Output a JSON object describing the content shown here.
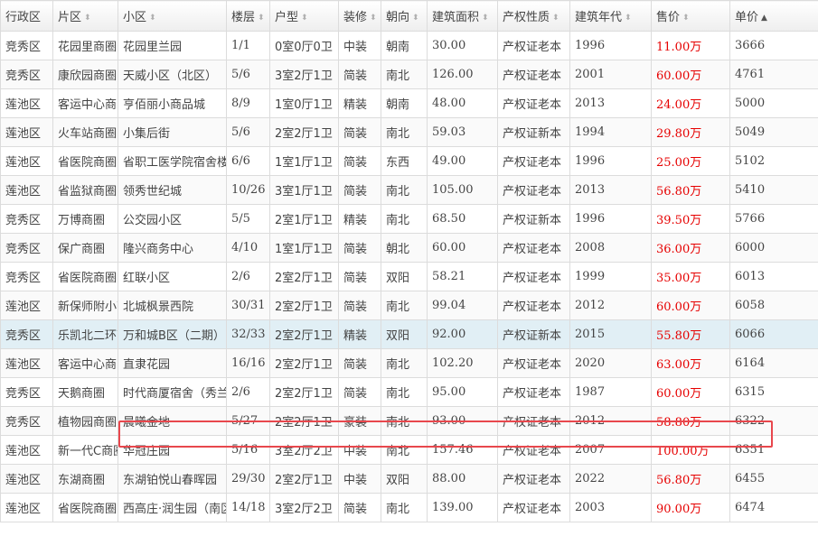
{
  "table": {
    "headers": [
      {
        "label": "行政区",
        "sortable": false
      },
      {
        "label": "片区",
        "sortable": true
      },
      {
        "label": "小区",
        "sortable": true
      },
      {
        "label": "楼层",
        "sortable": true
      },
      {
        "label": "户型",
        "sortable": true
      },
      {
        "label": "装修",
        "sortable": true
      },
      {
        "label": "朝向",
        "sortable": true
      },
      {
        "label": "建筑面积",
        "sortable": true
      },
      {
        "label": "产权性质",
        "sortable": true
      },
      {
        "label": "建筑年代",
        "sortable": true
      },
      {
        "label": "售价",
        "sortable": true
      },
      {
        "label": "单价",
        "sortable": true,
        "sort_direction": "asc"
      }
    ],
    "selected_row_index": 10,
    "boxed_row_index": 13,
    "rows": [
      [
        "竞秀区",
        "花园里商圈",
        "花园里兰园",
        "1/1",
        "0室0厅0卫",
        "中装",
        "朝南",
        "30.00",
        "产权证老本",
        "1996",
        "11.00万",
        "3666"
      ],
      [
        "竞秀区",
        "康欣园商圈",
        "天威小区（北区）",
        "5/6",
        "3室2厅1卫",
        "简装",
        "南北",
        "126.00",
        "产权证老本",
        "2001",
        "60.00万",
        "4761"
      ],
      [
        "莲池区",
        "客运中心商圈",
        "亨佰丽小商品城",
        "8/9",
        "1室0厅1卫",
        "精装",
        "朝南",
        "48.00",
        "产权证老本",
        "2013",
        "24.00万",
        "5000"
      ],
      [
        "莲池区",
        "火车站商圈",
        "小集后街",
        "5/6",
        "2室2厅1卫",
        "简装",
        "南北",
        "59.03",
        "产权证新本",
        "1994",
        "29.80万",
        "5049"
      ],
      [
        "莲池区",
        "省医院商圈",
        "省职工医学院宿舍楼",
        "6/6",
        "1室1厅1卫",
        "简装",
        "东西",
        "49.00",
        "产权证老本",
        "1996",
        "25.00万",
        "5102"
      ],
      [
        "莲池区",
        "省监狱商圈",
        "领秀世纪城",
        "10/26",
        "3室1厅1卫",
        "简装",
        "南北",
        "105.00",
        "产权证老本",
        "2013",
        "56.80万",
        "5410"
      ],
      [
        "竞秀区",
        "万博商圈",
        "公交园小区",
        "5/5",
        "2室1厅1卫",
        "精装",
        "南北",
        "68.50",
        "产权证新本",
        "1996",
        "39.50万",
        "5766"
      ],
      [
        "竞秀区",
        "保广商圈",
        "隆兴商务中心",
        "4/10",
        "1室1厅1卫",
        "简装",
        "朝北",
        "60.00",
        "产权证老本",
        "2008",
        "36.00万",
        "6000"
      ],
      [
        "竞秀区",
        "省医院商圈",
        "红联小区",
        "2/6",
        "2室2厅1卫",
        "简装",
        "双阳",
        "58.21",
        "产权证老本",
        "1999",
        "35.00万",
        "6013"
      ],
      [
        "莲池区",
        "新保师附小商圈",
        "北城枫景西院",
        "30/31",
        "2室2厅1卫",
        "简装",
        "南北",
        "99.04",
        "产权证老本",
        "2012",
        "60.00万",
        "6058"
      ],
      [
        "竞秀区",
        "乐凯北二环商圈",
        "万和城B区（二期）",
        "32/33",
        "2室2厅1卫",
        "精装",
        "双阳",
        "92.00",
        "产权证新本",
        "2015",
        "55.80万",
        "6066"
      ],
      [
        "莲池区",
        "客运中心商圈",
        "直隶花园",
        "16/16",
        "2室2厅1卫",
        "简装",
        "南北",
        "102.20",
        "产权证老本",
        "2020",
        "63.00万",
        "6164"
      ],
      [
        "竞秀区",
        "天鹅商圈",
        "时代商厦宿舍（秀兰）",
        "2/6",
        "2室2厅1卫",
        "简装",
        "南北",
        "95.00",
        "产权证老本",
        "1987",
        "60.00万",
        "6315"
      ],
      [
        "竞秀区",
        "植物园商圈",
        "晨曦金地",
        "5/27",
        "2室2厅1卫",
        "豪装",
        "南北",
        "93.00",
        "产权证老本",
        "2012",
        "58.80万",
        "6322"
      ],
      [
        "莲池区",
        "新一代C商圈",
        "华冠庄园",
        "5/16",
        "3室2厅2卫",
        "中装",
        "南北",
        "157.46",
        "产权证老本",
        "2007",
        "100.00万",
        "6351"
      ],
      [
        "莲池区",
        "东湖商圈",
        "东湖铂悦山春晖园",
        "29/30",
        "2室2厅1卫",
        "中装",
        "双阳",
        "88.00",
        "产权证老本",
        "2022",
        "56.80万",
        "6455"
      ],
      [
        "莲池区",
        "省医院商圈",
        "西高庄·润生园（南区）",
        "14/18",
        "3室2厅2卫",
        "简装",
        "南北",
        "139.00",
        "产权证老本",
        "2003",
        "90.00万",
        "6474"
      ]
    ]
  },
  "colors": {
    "price_text": "#e60000",
    "selected_row_bg": "#e1eff5",
    "highlight_box": "#e8474d",
    "grid_line": "#dcdcdc"
  }
}
